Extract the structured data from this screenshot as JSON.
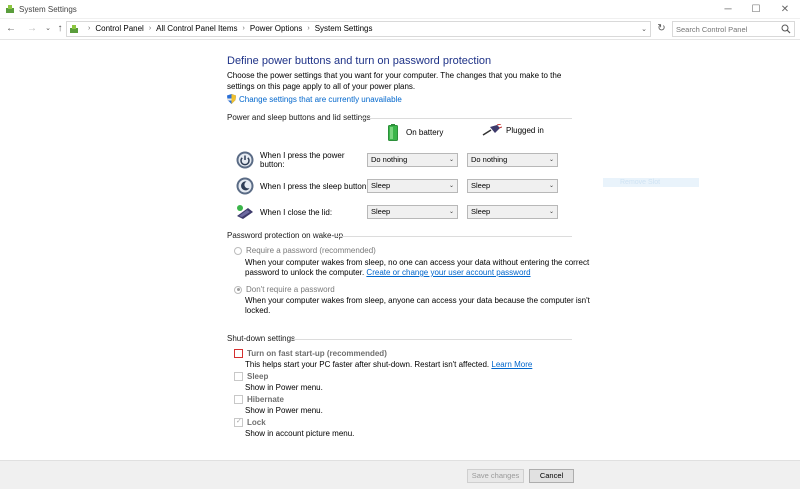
{
  "window": {
    "title": "System Settings",
    "minimize_glyph": "─",
    "maximize_glyph": "☐",
    "close_glyph": "✕"
  },
  "address": {
    "back_glyph": "←",
    "forward_glyph": "→",
    "history_glyph": "⌄",
    "up_glyph": "↑",
    "crumb_separator": "›",
    "breadcrumbs": [
      "Control Panel",
      "All Control Panel Items",
      "Power Options",
      "System Settings"
    ],
    "dropdown_glyph": "⌄",
    "refresh_glyph": "↻",
    "search_placeholder": "Search Control Panel"
  },
  "page": {
    "heading": "Define power buttons and turn on password protection",
    "intro": "Choose the power settings that you want for your computer. The changes that you make to the settings on this page apply to all of your power plans.",
    "change_link": "Change settings that are currently unavailable"
  },
  "power_section": {
    "title": "Power and sleep buttons and lid settings",
    "col_battery": "On battery",
    "col_plugged": "Plugged in",
    "rows": [
      {
        "label": "When I press the power button:",
        "battery": "Do nothing",
        "plugged": "Do nothing",
        "icon": "power-button-icon"
      },
      {
        "label": "When I press the sleep button:",
        "battery": "Sleep",
        "plugged": "Sleep",
        "icon": "sleep-button-icon"
      },
      {
        "label": "When I close the lid:",
        "battery": "Sleep",
        "plugged": "Sleep",
        "icon": "laptop-lid-icon"
      }
    ]
  },
  "password_section": {
    "title": "Password protection on wake-up",
    "require_label": "Require a password (recommended)",
    "require_desc_1": "When your computer wakes from sleep, no one can access your data without entering the correct",
    "require_desc_2": "password to unlock the computer.",
    "require_link": "Create or change your user account password",
    "norequire_label": "Don't require a password",
    "norequire_desc_1": "When your computer wakes from sleep, anyone can access your data because the computer isn't",
    "norequire_desc_2": "locked.",
    "selected": "norequire"
  },
  "shutdown_section": {
    "title": "Shut-down settings",
    "items": [
      {
        "label": "Turn on fast start-up (recommended)",
        "desc": "This helps start your PC faster after shut-down. Restart isn't affected.",
        "link": "Learn More",
        "checked": false,
        "focused": true
      },
      {
        "label": "Sleep",
        "desc": "Show in Power menu.",
        "checked": false
      },
      {
        "label": "Hibernate",
        "desc": "Show in Power menu.",
        "checked": false
      },
      {
        "label": "Lock",
        "desc": "Show in account picture menu.",
        "checked": true
      }
    ]
  },
  "ghost_item": "Remove Slot",
  "select_arrow_glyph": "⌄",
  "footer": {
    "save_label": "Save changes",
    "cancel_label": "Cancel"
  },
  "colors": {
    "heading": "#1e3287",
    "link": "#0066cc",
    "focus": "#d43030",
    "battery_green": "#3bb54a",
    "ghost": "#e9f3fb"
  }
}
